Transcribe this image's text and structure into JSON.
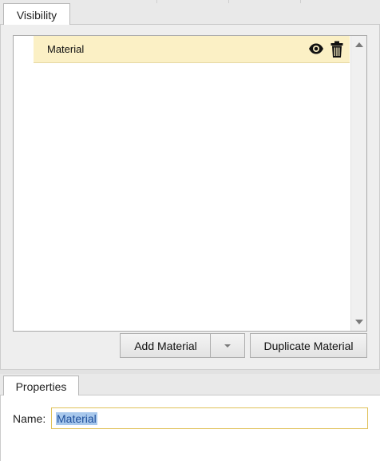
{
  "visibility_panel": {
    "tab_label": "Visibility",
    "items": [
      {
        "label": "Material",
        "icons": [
          "eye-icon",
          "trash-icon"
        ]
      }
    ],
    "add_button_label": "Add Material",
    "duplicate_button_label": "Duplicate Material"
  },
  "properties_panel": {
    "tab_label": "Properties",
    "name_label": "Name:",
    "name_value": "Material"
  },
  "colors": {
    "selected_item_bg": "#fbf0c5",
    "input_focus_border": "#e0c15a",
    "text_selection_bg": "#a8c8ec"
  }
}
